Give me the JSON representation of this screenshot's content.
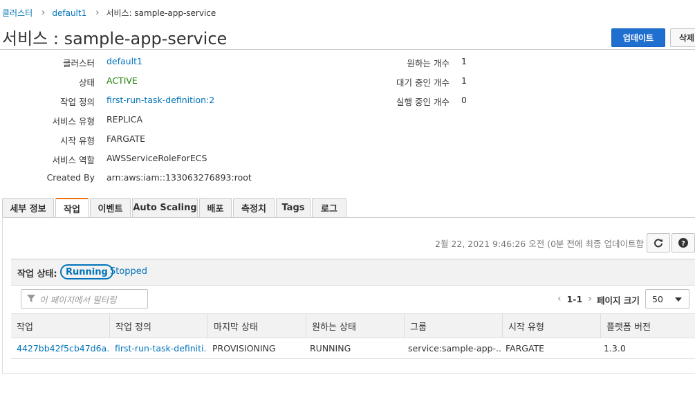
{
  "breadcrumb": {
    "cluster": "클러스터",
    "cluster_name": "default1",
    "current": "서비스: sample-app-service"
  },
  "page_title": "서비스 : sample-app-service",
  "actions": {
    "update": "업데이트",
    "delete": "삭제"
  },
  "details_left": [
    {
      "label": "클러스터",
      "value": "default1",
      "style": "blue"
    },
    {
      "label": "상태",
      "value": "ACTIVE",
      "style": "green"
    },
    {
      "label": "작업 정의",
      "value": "first-run-task-definition:2",
      "style": "blue"
    },
    {
      "label": "서비스 유형",
      "value": "REPLICA",
      "style": "plain"
    },
    {
      "label": "시작 유형",
      "value": "FARGATE",
      "style": "plain"
    },
    {
      "label": "서비스 역할",
      "value": "AWSServiceRoleForECS",
      "style": "plain"
    },
    {
      "label": "Created By",
      "value": "arn:aws:iam::133063276893:root",
      "style": "plain"
    }
  ],
  "details_right": [
    {
      "label": "원하는 개수",
      "value": "1"
    },
    {
      "label": "대기 중인 개수",
      "value": "1"
    },
    {
      "label": "실행 중인 개수",
      "value": "0"
    }
  ],
  "tabs": [
    {
      "label": "세부 정보",
      "active": false
    },
    {
      "label": "작업",
      "active": true
    },
    {
      "label": "이벤트",
      "active": false
    },
    {
      "label": "Auto Scaling",
      "active": false
    },
    {
      "label": "배포",
      "active": false
    },
    {
      "label": "측정치",
      "active": false
    },
    {
      "label": "Tags",
      "active": false
    },
    {
      "label": "로그",
      "active": false
    }
  ],
  "last_updated": "2월 22, 2021 9:46:26 오전 (0분 전에 최종 업데이트함",
  "task_status": {
    "label": "작업 상태:",
    "running": "Running",
    "stopped": "Stopped"
  },
  "filter": {
    "placeholder": "이 페이지에서 필터링"
  },
  "pagination": {
    "range": "1-1",
    "page_size_label": "페이지 크기",
    "page_size": "50"
  },
  "table": {
    "columns": [
      "작업",
      "작업 정의",
      "마지막 상태",
      "원하는 상태",
      "그룹",
      "시작 유형",
      "플랫폼 버전"
    ],
    "rows": [
      [
        "4427bb42f5cb47d6a...",
        "first-run-task-definiti...",
        "PROVISIONING",
        "RUNNING",
        "service:sample-app-...",
        "FARGATE",
        "1.3.0"
      ]
    ]
  },
  "colors": {
    "link": "#0073bb",
    "active": "#1d8102",
    "primary": "#1f6fd1",
    "tab_accent": "#ec7211"
  }
}
